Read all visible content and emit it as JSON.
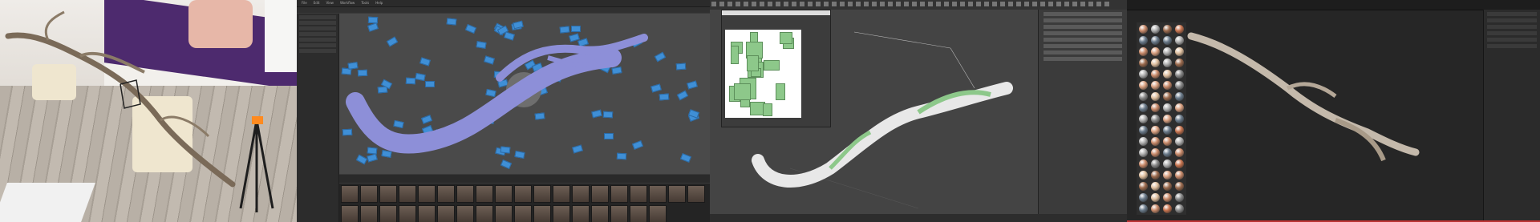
{
  "panels": {
    "photo": {
      "label": ""
    },
    "photogrammetry": {
      "menu": [
        "File",
        "Edit",
        "View",
        "Workflow",
        "Tools",
        "Help"
      ]
    },
    "uv_editor": {
      "title": ""
    },
    "renderer": {
      "title": ""
    }
  },
  "colors": {
    "camera_blue": "#3f8fd6",
    "mesh_lavender": "#8d8fd8",
    "uv_green": "#8dc88a",
    "mesh_white": "#e8e8e8"
  }
}
